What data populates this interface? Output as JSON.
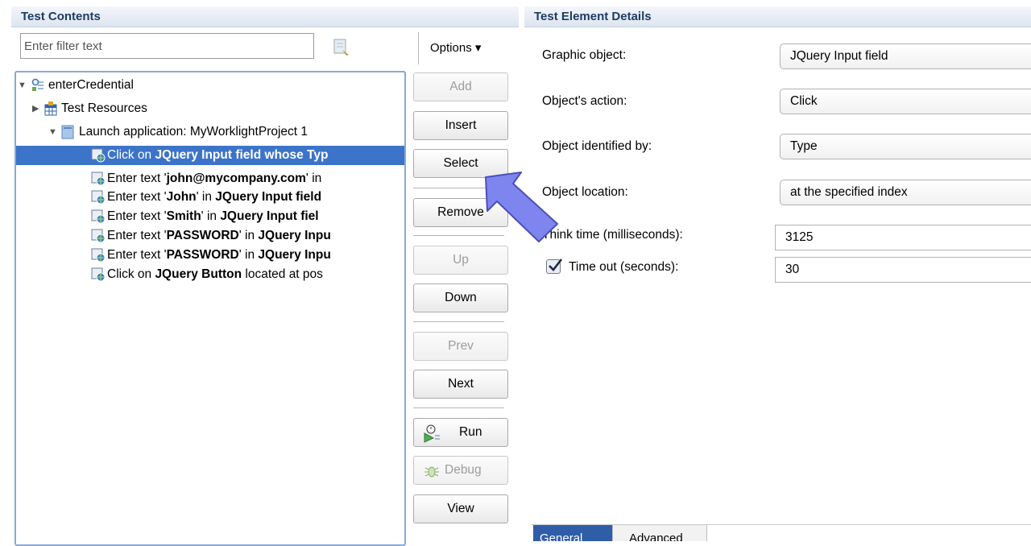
{
  "left_panel": {
    "title": "Test Contents",
    "filter_placeholder": "Enter filter text",
    "options_label": "Options ▾",
    "tree": [
      {
        "prefix": "",
        "bold": "",
        "suffix": "enterCredential"
      },
      {
        "prefix": "",
        "bold": "",
        "suffix": "Test Resources"
      },
      {
        "prefix": "",
        "bold": "",
        "suffix": "Launch application: MyWorklightProject  1"
      },
      {
        "prefix": "Click on ",
        "bold": "JQuery Input field",
        "suffix": " whose Typ"
      },
      {
        "prefix": "Enter text '",
        "bold": "john@mycompany.com",
        "suffix": "' in"
      },
      {
        "prefix": "Enter text '",
        "bold": "John",
        "suffix": "' in JQuery Input field"
      },
      {
        "prefix": "Enter text '",
        "bold": "Smith",
        "suffix": "' in JQuery Input fiel"
      },
      {
        "prefix": "Enter text '",
        "bold": "PASSWORD",
        "suffix": "' in JQuery Inpu"
      },
      {
        "prefix": "Enter text '",
        "bold": "PASSWORD",
        "suffix": "' in JQuery Inpu"
      },
      {
        "prefix": "Click on ",
        "bold": "JQuery Button",
        "suffix": " located at pos"
      }
    ],
    "tree_bold_tail": [
      "",
      "",
      "",
      "",
      "",
      "JQuery Input field",
      "JQuery Input fiel",
      "JQuery Inpu",
      "JQuery Inpu",
      ""
    ]
  },
  "buttons": {
    "add": "Add",
    "insert": "Insert",
    "select": "Select",
    "remove": "Remove",
    "up": "Up",
    "down": "Down",
    "prev": "Prev",
    "next": "Next",
    "run": "Run",
    "debug": "Debug",
    "view": "View"
  },
  "right_panel": {
    "title": "Test Element Details",
    "graphic_object_label": "Graphic object:",
    "graphic_object_value": "JQuery Input field",
    "object_action_label": "Object's action:",
    "object_action_value": "Click",
    "identified_by_label": "Object identified by:",
    "identified_by_value": "Type",
    "location_label": "Object location:",
    "location_value": "at the specified index",
    "think_time_label": "Think time (milliseconds):",
    "think_time_value": "3125",
    "timeout_label": "Time out (seconds):",
    "timeout_value": "30",
    "timeout_checked": true,
    "tabs": [
      "General",
      "Advanced"
    ]
  },
  "colors": {
    "selection": "#3c74c9",
    "header_text": "#1f3b63",
    "arrow": "#7f85ee"
  }
}
